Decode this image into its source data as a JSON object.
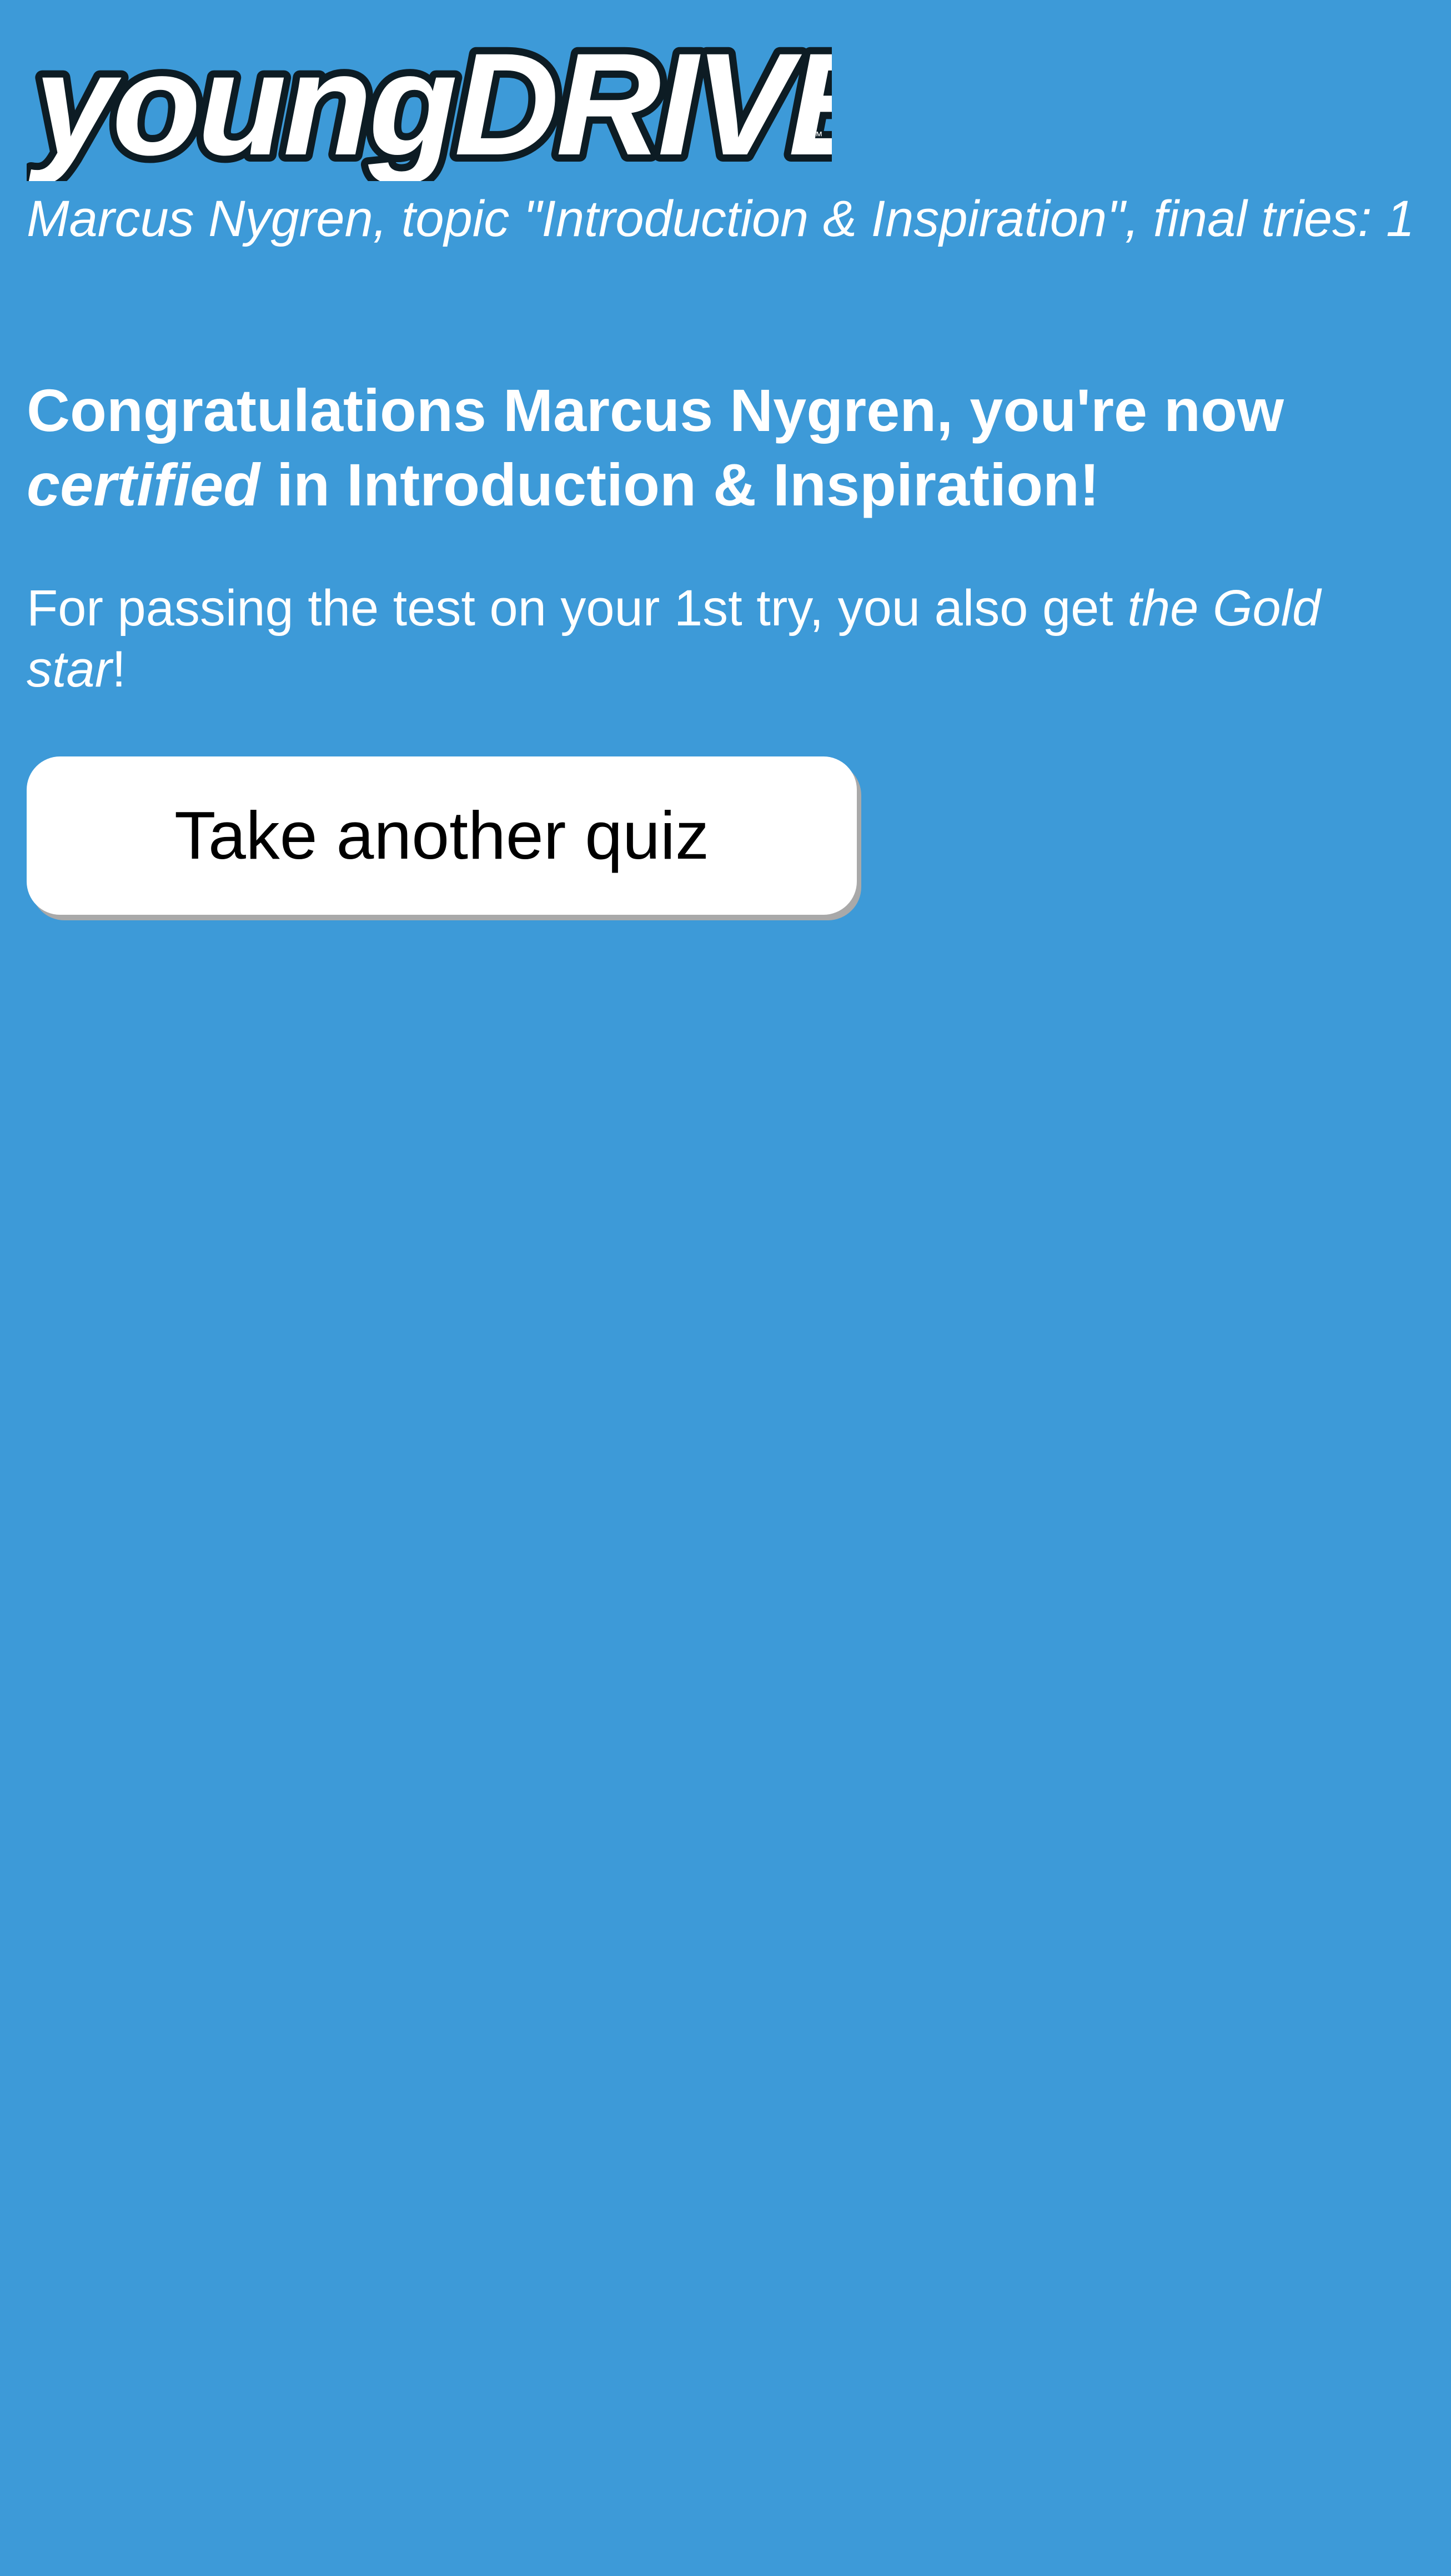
{
  "brand": {
    "logo_text": "youngDRIVE!",
    "trademark": "™"
  },
  "quiz_result": {
    "status_line": "Marcus Nygren, topic \"Introduction & Inspiration\", final tries: 1",
    "headline": {
      "prefix": "Congratulations Marcus Nygren, you're now ",
      "emphasis": "certified",
      "suffix": " in Introduction & Inspiration!"
    },
    "reward": {
      "prefix": "For passing the test on your 1st try, you also get ",
      "emphasis": "the Gold star",
      "suffix": "!"
    }
  },
  "actions": {
    "take_another_label": "Take another quiz"
  },
  "colors": {
    "background": "#3d9ad8",
    "text": "#ffffff",
    "logo_outline": "#0d1c24",
    "button_background": "#ffffff",
    "button_text": "#000000",
    "button_shadow": "#a9a9a9"
  }
}
